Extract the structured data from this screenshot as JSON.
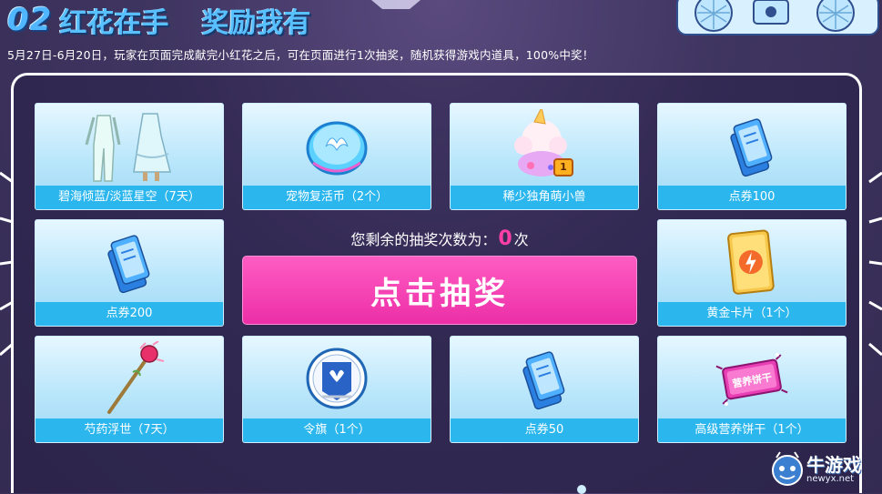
{
  "header": {
    "title_number": "02",
    "title_part1": "红花在手",
    "title_part2": "奖励我有",
    "description": "5月27日-6月20日，玩家在页面完成献完小红花之后，可在页面进行1次抽奖，随机获得游戏内道具，100%中奖！"
  },
  "prizes": [
    {
      "label": "碧海倾蓝/淡蓝星空（7天）",
      "icon": "outfit-icon"
    },
    {
      "label": "宠物复活币（2个）",
      "icon": "revive-coin-icon"
    },
    {
      "label": "稀少独角萌小兽",
      "icon": "unicorn-pet-icon",
      "badge": "1"
    },
    {
      "label": "点券100",
      "icon": "voucher-icon"
    },
    {
      "label": "点券200",
      "icon": "voucher-icon"
    },
    {
      "label": "黄金卡片（1个）",
      "icon": "gold-card-icon"
    },
    {
      "label": "芍药浮世（7天）",
      "icon": "wand-icon"
    },
    {
      "label": "令旗（1个）",
      "icon": "banner-flag-icon"
    },
    {
      "label": "点券50",
      "icon": "voucher-icon"
    },
    {
      "label": "高级营养饼干（1个）",
      "icon": "biscuit-icon",
      "icon_text": "营养饼干"
    }
  ],
  "draw": {
    "remaining_prefix": "您剩余的抽奖次数为：",
    "remaining_count": "0",
    "remaining_suffix": "次",
    "button_label": "点击抽奖"
  },
  "watermark": {
    "name": "牛游戏",
    "domain": "newyx.net"
  },
  "colors": {
    "accent_blue": "#2cb6ee",
    "button_pink": "#ec2fa7",
    "count_pink": "#ff3fa6"
  }
}
